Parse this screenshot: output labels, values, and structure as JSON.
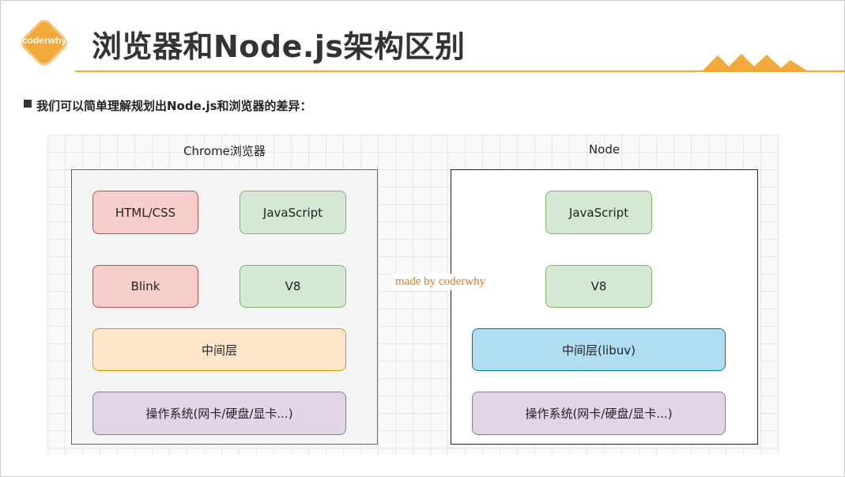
{
  "header": {
    "logo_text": "coderwhy",
    "title": "浏览器和Node.js架构区别"
  },
  "subtitle": "我们可以简单理解规划出Node.js和浏览器的差异：",
  "diagram": {
    "chrome": {
      "label": "Chrome浏览器",
      "boxes": {
        "html_css": "HTML/CSS",
        "javascript": "JavaScript",
        "blink": "Blink",
        "v8": "V8",
        "middle_layer": "中间层",
        "os": "操作系统(网卡/硬盘/显卡...)"
      }
    },
    "node": {
      "label": "Node",
      "boxes": {
        "javascript": "JavaScript",
        "v8": "V8",
        "middle_layer": "中间层(libuv)",
        "os": "操作系统(网卡/硬盘/显卡...)"
      }
    },
    "watermark": "made by coderwhy"
  },
  "colors": {
    "accent": "#f0a93a",
    "red_fill": "#f8cecc",
    "green_fill": "#d5e8d4",
    "orange_fill": "#ffe6cc",
    "purple_fill": "#e1d5e7",
    "blue_fill": "#b1ddf0"
  }
}
